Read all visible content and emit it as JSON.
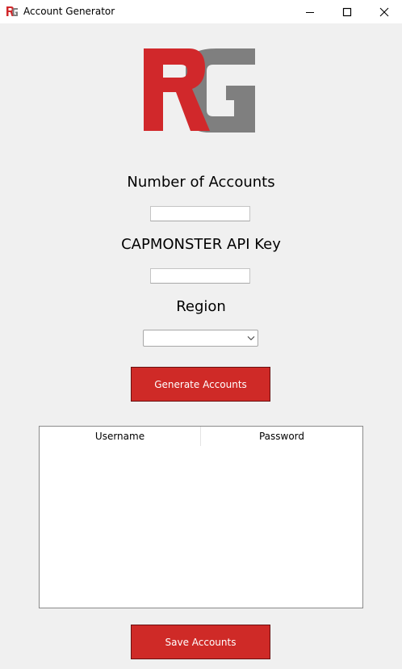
{
  "window": {
    "title": "Account Generator",
    "icon": "rg-logo-icon"
  },
  "logo": {
    "letters": "RG",
    "colors": {
      "r": "#d1282b",
      "g": "#7f7f7f"
    }
  },
  "form": {
    "accounts_label": "Number of Accounts",
    "accounts_value": "",
    "api_label": "CAPMONSTER API Key",
    "api_value": "",
    "region_label": "Region",
    "region_value": ""
  },
  "actions": {
    "generate_label": "Generate Accounts",
    "save_label": "Save Accounts"
  },
  "table": {
    "columns": [
      "Username",
      "Password"
    ],
    "rows": []
  },
  "colors": {
    "accent": "#cf2a27",
    "background": "#f0f0f0"
  }
}
